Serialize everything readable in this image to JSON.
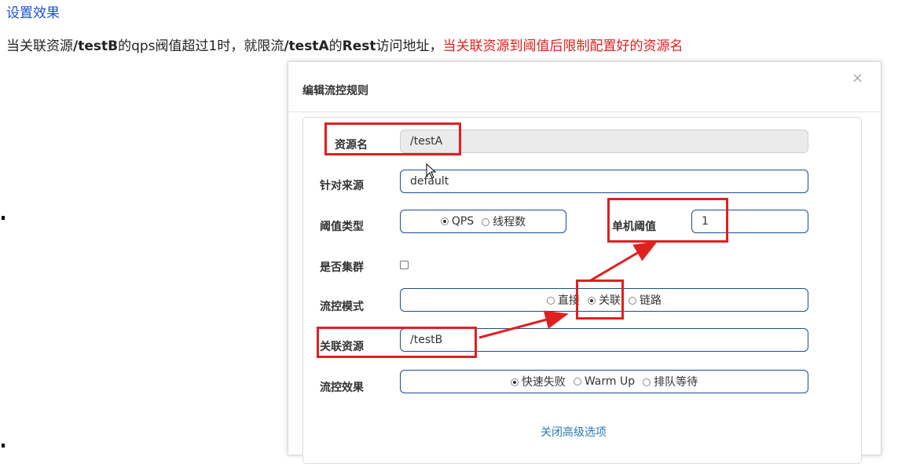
{
  "page": {
    "heading": "设置效果",
    "desc_part1": "当关联资源",
    "desc_testb": "/testB",
    "desc_part2": "的qps阀值超过1时，就限流",
    "desc_testa": "/testA",
    "desc_part3": "的",
    "desc_rest": "Rest",
    "desc_part4": "访问地址，",
    "desc_red": "当关联资源到阈值后限制配置好的资源名"
  },
  "modal": {
    "title": "编辑流控规则",
    "close": "×",
    "resource_label": "资源名",
    "resource_value": "/testA",
    "origin_label": "针对来源",
    "origin_value": "default",
    "threshold_type_label": "阈值类型",
    "threshold_type_options": [
      "QPS",
      "线程数"
    ],
    "threshold_type_selected": "QPS",
    "single_threshold_label": "单机阈值",
    "single_threshold_value": "1",
    "cluster_label": "是否集群",
    "mode_label": "流控模式",
    "mode_options": [
      "直接",
      "关联",
      "链路"
    ],
    "mode_selected": "关联",
    "related_label": "关联资源",
    "related_value": "/testB",
    "effect_label": "流控效果",
    "effect_options": [
      "快速失败",
      "Warm Up",
      "排队等待"
    ],
    "effect_selected": "快速失败",
    "advanced_link": "关闭高级选项"
  },
  "colors": {
    "heading": "#1a4fd6",
    "annotation_red": "#e0201f",
    "input_border": "#1e4e8c",
    "link": "#2a7ab9"
  }
}
